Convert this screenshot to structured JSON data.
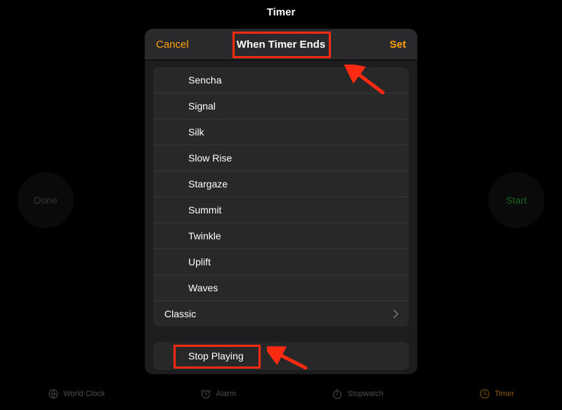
{
  "page_title": "Timer",
  "background_buttons": {
    "done": "Done",
    "start": "Start"
  },
  "popover": {
    "cancel": "Cancel",
    "title": "When Timer Ends",
    "set": "Set",
    "tones": [
      "Sencha",
      "Signal",
      "Silk",
      "Slow Rise",
      "Stargaze",
      "Summit",
      "Twinkle",
      "Uplift",
      "Waves"
    ],
    "classic": "Classic",
    "stop_playing": "Stop Playing"
  },
  "tabs": {
    "world_clock": "World Clock",
    "alarm": "Alarm",
    "stopwatch": "Stopwatch",
    "timer": "Timer"
  },
  "colors": {
    "accent": "#ff9f0a",
    "start": "#2aa33a",
    "annotation": "#ff2a12"
  }
}
